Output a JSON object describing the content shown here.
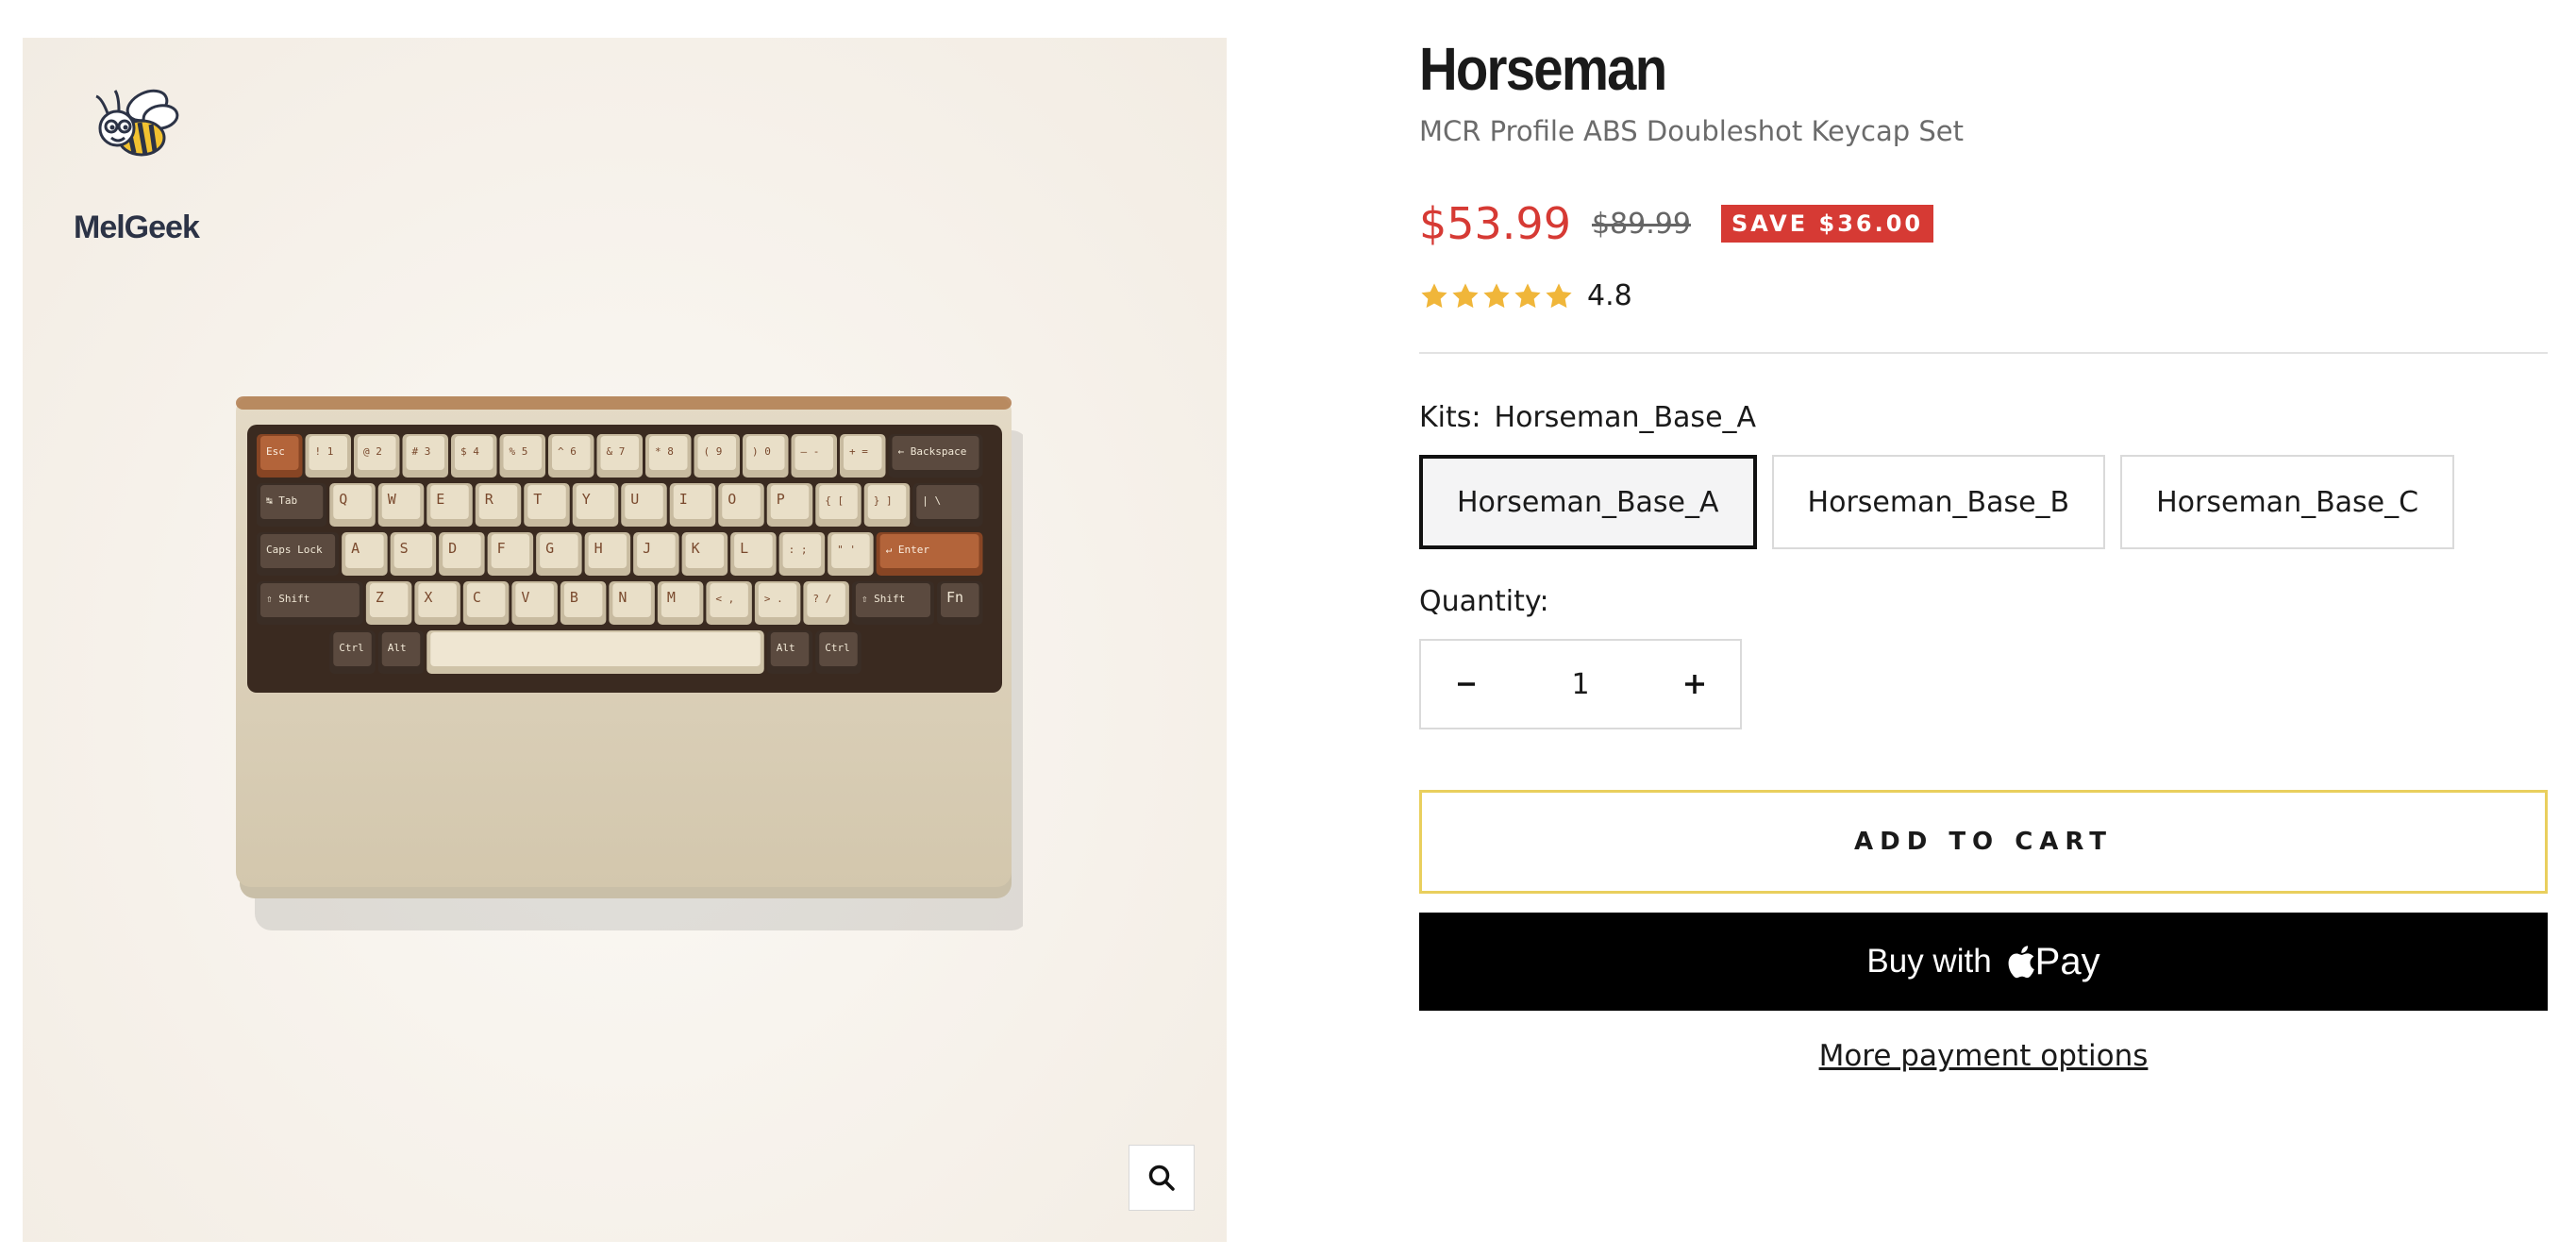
{
  "brand": {
    "name": "MelGeek"
  },
  "product": {
    "title": "Horseman",
    "subtitle": "MCR Profile ABS Doubleshot Keycap Set",
    "price": "$53.99",
    "compare_price": "$89.99",
    "save_badge": "SAVE $36.00",
    "rating": "4.8",
    "rating_stars": 5
  },
  "kits": {
    "label": "Kits:",
    "selected": "Horseman_Base_A",
    "options": [
      "Horseman_Base_A",
      "Horseman_Base_B",
      "Horseman_Base_C"
    ]
  },
  "quantity": {
    "label": "Quantity:",
    "value": "1"
  },
  "actions": {
    "add_to_cart": "ADD TO CART",
    "buy_with": "Buy with",
    "pay": "Pay",
    "more_payment": "More payment options"
  },
  "colors": {
    "sale": "#d63a34",
    "star": "#f0b63a",
    "add_border": "#e9cf5d"
  },
  "icons": {
    "zoom": "search-icon",
    "minus": "minus-icon",
    "plus": "plus-icon",
    "apple": "apple-icon"
  },
  "keyboard": {
    "rows": [
      [
        "Esc",
        "! 1",
        "@ 2",
        "# 3",
        "$ 4",
        "% 5",
        "^ 6",
        "& 7",
        "* 8",
        "( 9",
        ") 0",
        "— -",
        "+ =",
        "← Backspace"
      ],
      [
        "↹ Tab",
        "Q",
        "W",
        "E",
        "R",
        "T",
        "Y",
        "U",
        "I",
        "O",
        "P",
        "{ [",
        "} ]",
        "| \\"
      ],
      [
        "Caps Lock",
        "A",
        "S",
        "D",
        "F",
        "G",
        "H",
        "J",
        "K",
        "L",
        ": ;",
        "\" '",
        "↵ Enter"
      ],
      [
        "⇧ Shift",
        "Z",
        "X",
        "C",
        "V",
        "B",
        "N",
        "M",
        "< ,",
        "> .",
        "? /",
        "⇧ Shift",
        "Fn"
      ],
      [
        "Ctrl",
        "Alt",
        "",
        "Alt",
        "Ctrl"
      ]
    ]
  }
}
